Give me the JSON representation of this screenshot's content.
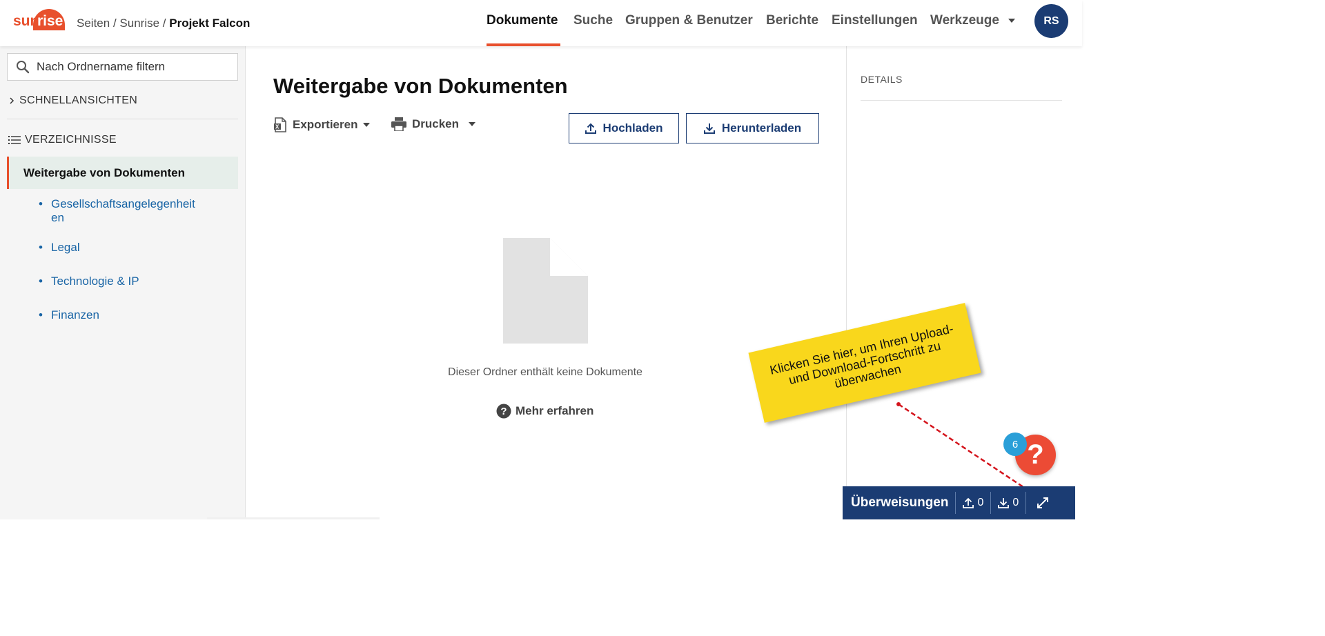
{
  "header": {
    "logo_text": "sunrise",
    "breadcrumb": {
      "part1": "Seiten",
      "sep": "/",
      "part2": "Sunrise",
      "current": "Projekt Falcon"
    },
    "nav": [
      "Dokumente",
      "Suche",
      "Gruppen & Benutzer",
      "Berichte",
      "Einstellungen",
      "Werkzeuge"
    ],
    "active_nav": "Dokumente",
    "avatar_initials": "RS",
    "accent_color": "#e8502d",
    "brand_color": "#1b3c73"
  },
  "sidebar": {
    "filter_placeholder": "Nach Ordnername filtern",
    "quick_views": "SCHNELLANSICHTEN",
    "directories": "VERZEICHNISSE",
    "active_folder": "Weitergabe von Dokumenten",
    "subfolders": [
      "Gesellschaftsangelegenheit en",
      "Legal",
      "Technologie & IP",
      "Finanzen"
    ]
  },
  "main": {
    "title": "Weitergabe von Dokumenten",
    "export_label": "Exportieren",
    "print_label": "Drucken",
    "upload_label": "Hochladen",
    "download_label": "Herunterladen",
    "empty_text": "Dieser Ordner enthält keine Dokumente",
    "learn_more": "Mehr erfahren"
  },
  "details": {
    "title": "DETAILS"
  },
  "callout": {
    "text": "Klicken Sie hier, um Ihren Upload- und Download-Fortschritt zu überwachen"
  },
  "help": {
    "badge_count": "6",
    "symbol": "?"
  },
  "transfers": {
    "label": "Überweisungen",
    "upload_count": "0",
    "download_count": "0"
  }
}
